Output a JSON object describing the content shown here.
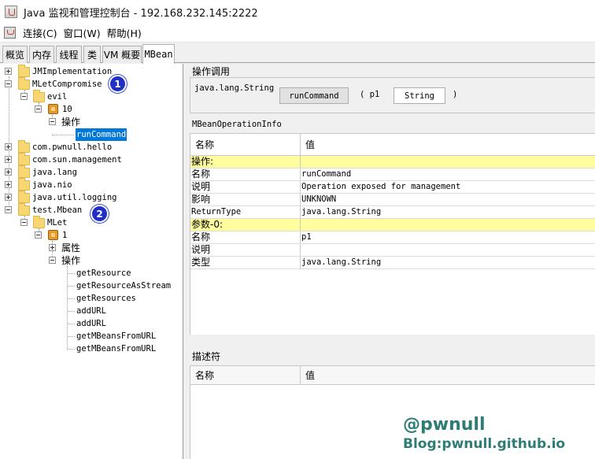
{
  "window": {
    "title": "Java 监视和管理控制台 - 192.168.232.145:2222"
  },
  "menubar": {
    "items": [
      "连接(C)",
      "窗口(W)",
      "帮助(H)"
    ]
  },
  "tabs": [
    "概览",
    "内存",
    "线程",
    "类",
    "VM 概要",
    "MBean"
  ],
  "active_tab": "MBean",
  "tree": {
    "jmimplementation": "JMImplementation",
    "mletcompromise": "MLetCompromise",
    "evil": "evil",
    "evil_10": "10",
    "evil_ops": "操作",
    "run_command": "runCommand",
    "pwnull_hello": "com.pwnull.hello",
    "sun_management": "com.sun.management",
    "java_lang": "java.lang",
    "java_nio": "java.nio",
    "java_util_logging": "java.util.logging",
    "test_mbean": "test.Mbean",
    "mlet": "MLet",
    "mlet_1": "1",
    "attrs": "属性",
    "ops": "操作",
    "ops_items": [
      "getResource",
      "getResourceAsStream",
      "getResources",
      "addURL",
      "addURL",
      "getMBeansFromURL",
      "getMBeansFromURL"
    ]
  },
  "badges": [
    "1",
    "2"
  ],
  "operation": {
    "section_title": "操作调用",
    "return_type": "java.lang.String",
    "button": "runCommand",
    "open_paren": "( p1",
    "param_value": "String",
    "close_paren": ")"
  },
  "info": {
    "section_title": "MBeanOperationInfo",
    "header": {
      "name": "名称",
      "value": "值"
    },
    "rows": [
      {
        "name": "操作:",
        "value": "",
        "highlight": true
      },
      {
        "name": "名称",
        "value": "runCommand"
      },
      {
        "name": "说明",
        "value": "Operation exposed for management"
      },
      {
        "name": "影响",
        "value": "UNKNOWN"
      },
      {
        "name": "ReturnType",
        "value": "java.lang.String"
      },
      {
        "name": "参数-0:",
        "value": "",
        "highlight": true
      },
      {
        "name": "名称",
        "value": "p1"
      },
      {
        "name": "说明",
        "value": ""
      },
      {
        "name": "类型",
        "value": "java.lang.String"
      }
    ]
  },
  "descriptor": {
    "section_title": "描述符",
    "header": {
      "name": "名称",
      "value": "值"
    }
  },
  "watermark": {
    "line1": "@pwnull",
    "line2": "Blog:pwnull.github.io"
  },
  "colors": {
    "selection": "#0078d7",
    "highlight_row": "#fffd9e",
    "badge": "#1f2fc8",
    "watermark": "#2e7d75"
  }
}
